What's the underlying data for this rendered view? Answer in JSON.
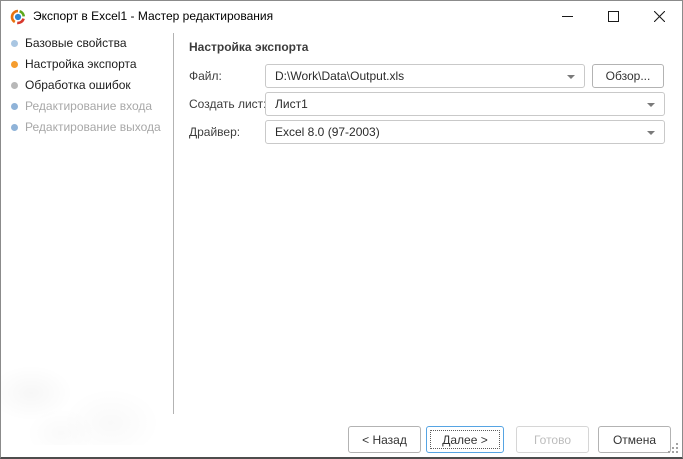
{
  "window": {
    "title": "Экспорт в Excel1 - Мастер редактирования",
    "icons": {
      "app": "app-icon",
      "minimize": "minimize-icon",
      "maximize": "maximize-icon",
      "close": "close-icon",
      "combo_arrow": "chevron-down-icon",
      "resize": "resize-grip"
    }
  },
  "sidebar": {
    "items": [
      {
        "label": "Базовые свойства",
        "dot_color": "#a9c6e2",
        "state": "enabled"
      },
      {
        "label": "Настройка экспорта",
        "dot_color": "#f59d2f",
        "state": "active"
      },
      {
        "label": "Обработка ошибок",
        "dot_color": "#b8b8b8",
        "state": "enabled"
      },
      {
        "label": "Редактирование входа",
        "dot_color": "#8fb3d8",
        "state": "disabled"
      },
      {
        "label": "Редактирование выхода",
        "dot_color": "#8fb3d8",
        "state": "disabled"
      }
    ]
  },
  "main": {
    "heading": "Настройка экспорта",
    "file": {
      "label": "Файл:",
      "value": "D:\\Work\\Data\\Output.xls",
      "browse_label": "Обзор..."
    },
    "sheet": {
      "label": "Создать лист:",
      "value": "Лист1"
    },
    "driver": {
      "label": "Драйвер:",
      "value": "Excel 8.0 (97-2003)"
    }
  },
  "footer": {
    "back_label": "< Назад",
    "next_label": "Далее >",
    "finish_label": "Готово",
    "cancel_label": "Отмена",
    "next_state": "focused",
    "finish_state": "disabled"
  },
  "colors": {
    "focus_border": "#56a4e3",
    "active_step_dot": "#f59d2f",
    "disabled_text": "#a8a8a8",
    "window_border": "#8b8b8b"
  }
}
